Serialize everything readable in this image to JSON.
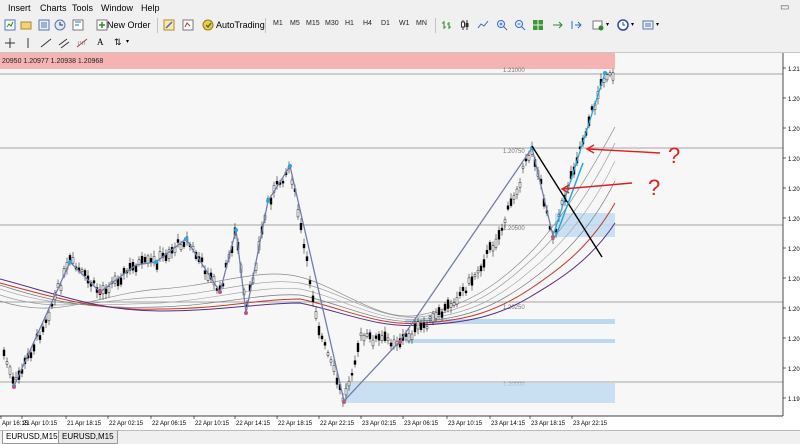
{
  "menu": {
    "items": [
      "Insert",
      "Charts",
      "Tools",
      "Window",
      "Help"
    ]
  },
  "toolbar": {
    "new_order_label": "New Order",
    "autotrading_label": "AutoTrading",
    "timeframes": [
      "M1",
      "M5",
      "M15",
      "M30",
      "H1",
      "H4",
      "D1",
      "W1",
      "MN"
    ]
  },
  "chart": {
    "ohlc_readout": "20950 1.20977 1.20938 1.20968",
    "level_labels": [
      "1.21000",
      "1.20750",
      "1.20500",
      "1.20250",
      "1.20000"
    ],
    "price_axis_labels": [
      "1.21",
      "1.20",
      "1.20",
      "1.20",
      "1.20",
      "1.20",
      "1.20",
      "1.20",
      "1.20",
      "1.20",
      "1.20",
      "1.19"
    ],
    "time_labels": [
      "Apr 16:15",
      "21 Apr 10:15",
      "21 Apr 18:15",
      "22 Apr 02:15",
      "22 Apr 06:15",
      "22 Apr 10:15",
      "22 Apr 14:15",
      "22 Apr 18:15",
      "22 Apr 22:15",
      "23 Apr 02:15",
      "23 Apr 06:15",
      "23 Apr 10:15",
      "23 Apr 14:15",
      "23 Apr 18:15",
      "23 Apr 22:15"
    ],
    "annotations": [
      "?",
      "?"
    ],
    "colors": {
      "ma_red": "#c0392b",
      "ma_purple": "#5b2c83",
      "zigzag": "#27a7e0",
      "arrow": "#e02020",
      "header_band": "#f6b3b3",
      "zone": "#bcd9ef"
    }
  },
  "tabs": {
    "items": [
      "EURUSD,M15",
      "EURUSD,M15"
    ]
  }
}
